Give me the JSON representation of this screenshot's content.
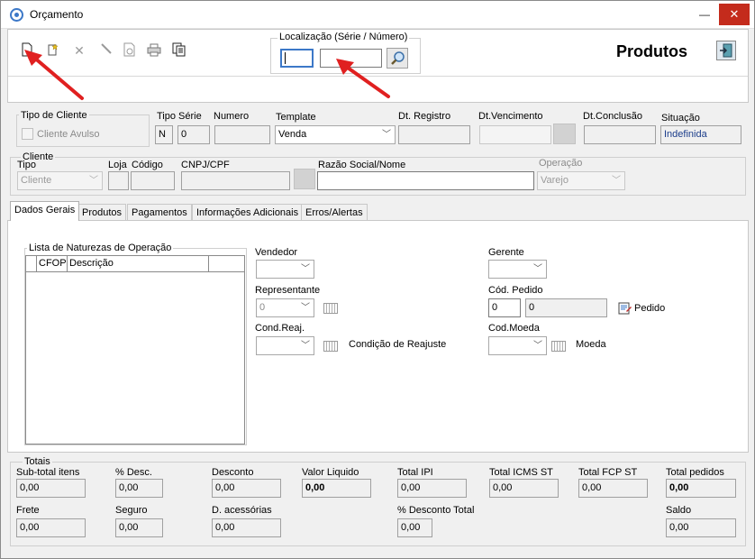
{
  "window": {
    "title": "Orçamento",
    "minimize": "—",
    "maximize": "☐",
    "close": "✕"
  },
  "toolbar": {
    "icons": [
      "new-document-icon",
      "magic-wand-icon",
      "delete-icon",
      "pen-icon",
      "preview-icon",
      "print-icon",
      "copy-icon"
    ]
  },
  "search": {
    "legend": "Localização (Série / Número)",
    "serie": "",
    "numero": ""
  },
  "header": {
    "title": "Produtos"
  },
  "tipo_cliente": {
    "legend": "Tipo de Cliente",
    "checkbox_label": "Cliente Avulso"
  },
  "doc": {
    "tipo_serie_label": "Tipo Série",
    "tipo_value": "N",
    "serie_value": "0",
    "numero_label": "Numero",
    "numero_value": "",
    "template_label": "Template",
    "template_value": "Venda",
    "dt_registro_label": "Dt. Registro",
    "dt_registro_value": "",
    "dt_vencimento_label": "Dt.Vencimento",
    "dt_vencimento_value": "",
    "dt_conclusao_label": "Dt.Conclusão",
    "dt_conclusao_value": "",
    "situacao_label": "Situação",
    "situacao_value": "Indefinida"
  },
  "cliente": {
    "legend": "Cliente",
    "tipo_label": "Tipo",
    "tipo_value": "Cliente",
    "loja_label": "Loja",
    "codigo_label": "Código",
    "cnpj_label": "CNPJ/CPF",
    "razao_label": "Razão Social/Nome",
    "operacao_label": "Operação",
    "operacao_value": "Varejo"
  },
  "tabs": [
    "Dados Gerais",
    "Produtos",
    "Pagamentos",
    "Informações Adicionais",
    "Erros/Alertas"
  ],
  "dados_gerais": {
    "naturezas_legend": "Lista de Naturezas de Operação",
    "columns": [
      "CFOP",
      "Descrição"
    ],
    "vendedor_label": "Vendedor",
    "representante_label": "Representante",
    "representante_value": "0",
    "cond_reaj_label": "Cond.Reaj.",
    "condicao_reajuste_label": "Condição de Reajuste",
    "gerente_label": "Gerente",
    "cod_pedido_label": "Cód. Pedido",
    "cod_pedido_value1": "0",
    "cod_pedido_value2": "0",
    "pedido_label": "Pedido",
    "cod_moeda_label": "Cod.Moeda",
    "moeda_label": "Moeda"
  },
  "totais": {
    "legend": "Totais",
    "row1": [
      {
        "label": "Sub-total itens",
        "value": "0,00",
        "bold": false
      },
      {
        "label": "% Desc.",
        "value": "0,00",
        "bold": false
      },
      {
        "label": "Desconto",
        "value": "0,00",
        "bold": false
      },
      {
        "label": "Valor Liquido",
        "value": "0,00",
        "bold": true
      },
      {
        "label": "Total IPI",
        "value": "0,00",
        "bold": false
      },
      {
        "label": "Total ICMS ST",
        "value": "0,00",
        "bold": false
      },
      {
        "label": "Total FCP ST",
        "value": "0,00",
        "bold": false
      },
      {
        "label": "Total pedidos",
        "value": "0,00",
        "bold": true
      }
    ],
    "row2": [
      {
        "label": "Frete",
        "value": "0,00"
      },
      {
        "label": "Seguro",
        "value": "0,00"
      },
      {
        "label": "D. acessórias",
        "value": "0,00"
      },
      {
        "label": "% Desconto Total",
        "value": "0,00"
      },
      {
        "label": "Saldo",
        "value": "0,00"
      }
    ]
  },
  "colors": {
    "annotation_arrow": "#e02020",
    "close_button": "#c42b1c"
  }
}
